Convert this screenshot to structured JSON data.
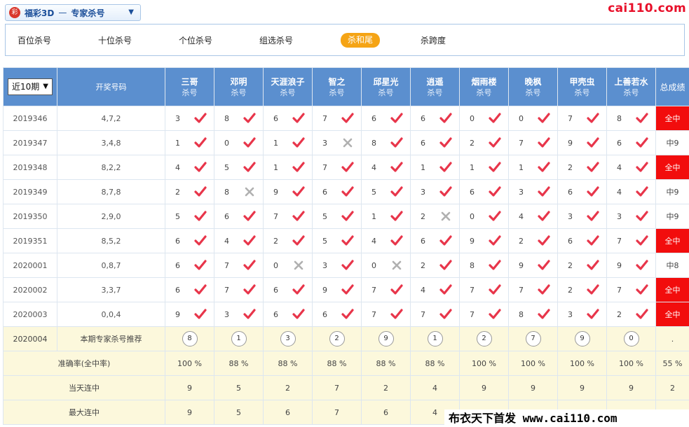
{
  "header": {
    "lottery": "福彩3D",
    "separator": "—",
    "section": "专家杀号",
    "brand": "cai110.com"
  },
  "tabs": [
    "百位杀号",
    "十位杀号",
    "个位杀号",
    "组选杀号",
    "杀和尾",
    "杀跨度"
  ],
  "active_tab": "杀和尾",
  "table": {
    "period_select": "近10期",
    "draw_header": "开奖号码",
    "total_header": "总成绩",
    "sub_label": "杀号",
    "experts": [
      "三哥",
      "邓明",
      "天涯浪子",
      "智之",
      "邱星光",
      "逍遥",
      "烟雨楼",
      "晚枫",
      "甲壳虫",
      "上善若水"
    ],
    "rows": [
      {
        "issue": "2019346",
        "draw": "4,7,2",
        "picks": [
          "3",
          "8",
          "6",
          "7",
          "6",
          "6",
          "0",
          "0",
          "7",
          "8"
        ],
        "hits": [
          true,
          true,
          true,
          true,
          true,
          true,
          true,
          true,
          true,
          true
        ],
        "total": "全中"
      },
      {
        "issue": "2019347",
        "draw": "3,4,8",
        "picks": [
          "1",
          "0",
          "1",
          "3",
          "8",
          "6",
          "2",
          "7",
          "9",
          "6"
        ],
        "hits": [
          true,
          true,
          true,
          false,
          true,
          true,
          true,
          true,
          true,
          true
        ],
        "total": "中9"
      },
      {
        "issue": "2019348",
        "draw": "8,2,2",
        "picks": [
          "4",
          "5",
          "1",
          "7",
          "4",
          "1",
          "1",
          "1",
          "2",
          "4"
        ],
        "hits": [
          true,
          true,
          true,
          true,
          true,
          true,
          true,
          true,
          true,
          true
        ],
        "total": "全中"
      },
      {
        "issue": "2019349",
        "draw": "8,7,8",
        "picks": [
          "2",
          "8",
          "9",
          "6",
          "5",
          "3",
          "6",
          "3",
          "6",
          "4"
        ],
        "hits": [
          true,
          false,
          true,
          true,
          true,
          true,
          true,
          true,
          true,
          true
        ],
        "total": "中9"
      },
      {
        "issue": "2019350",
        "draw": "2,9,0",
        "picks": [
          "5",
          "6",
          "7",
          "5",
          "1",
          "2",
          "0",
          "4",
          "3",
          "3"
        ],
        "hits": [
          true,
          true,
          true,
          true,
          true,
          false,
          true,
          true,
          true,
          true
        ],
        "total": "中9"
      },
      {
        "issue": "2019351",
        "draw": "8,5,2",
        "picks": [
          "6",
          "4",
          "2",
          "5",
          "4",
          "6",
          "9",
          "2",
          "6",
          "7"
        ],
        "hits": [
          true,
          true,
          true,
          true,
          true,
          true,
          true,
          true,
          true,
          true
        ],
        "total": "全中"
      },
      {
        "issue": "2020001",
        "draw": "0,8,7",
        "picks": [
          "6",
          "7",
          "0",
          "3",
          "0",
          "2",
          "8",
          "9",
          "2",
          "9"
        ],
        "hits": [
          true,
          true,
          false,
          true,
          false,
          true,
          true,
          true,
          true,
          true
        ],
        "total": "中8"
      },
      {
        "issue": "2020002",
        "draw": "3,3,7",
        "picks": [
          "6",
          "7",
          "6",
          "9",
          "7",
          "4",
          "7",
          "7",
          "2",
          "7"
        ],
        "hits": [
          true,
          true,
          true,
          true,
          true,
          true,
          true,
          true,
          true,
          true
        ],
        "total": "全中"
      },
      {
        "issue": "2020003",
        "draw": "0,0,4",
        "picks": [
          "9",
          "3",
          "6",
          "6",
          "7",
          "7",
          "7",
          "8",
          "3",
          "2"
        ],
        "hits": [
          true,
          true,
          true,
          true,
          true,
          true,
          true,
          true,
          true,
          true
        ],
        "total": "全中"
      }
    ],
    "recommend": {
      "issue": "2020004",
      "label": "本期专家杀号推荐",
      "balls": [
        "8",
        "1",
        "3",
        "2",
        "9",
        "1",
        "2",
        "7",
        "9",
        "0"
      ],
      "total": "."
    },
    "accuracy": {
      "label": "准确率(全中率)",
      "values": [
        "100 %",
        "88 %",
        "88 %",
        "88 %",
        "88 %",
        "88 %",
        "100 %",
        "100 %",
        "100 %",
        "100 %"
      ],
      "total": "55 %"
    },
    "current_streak": {
      "label": "当天连中",
      "values": [
        "9",
        "5",
        "2",
        "7",
        "2",
        "4",
        "9",
        "9",
        "9",
        "9"
      ],
      "total": "2"
    },
    "max_streak": {
      "label": "最大连中",
      "values": [
        "9",
        "5",
        "6",
        "7",
        "6",
        "4",
        "",
        "",
        "",
        ""
      ],
      "total": ""
    }
  },
  "watermark": "布衣天下首发 www.cai110.com",
  "colors": {
    "header_blue": "#5b8fcf",
    "hit_red": "#e8354a",
    "miss_gray": "#b0b0b0",
    "full_hit_bg": "#f20d0d",
    "tab_active": "#f5a415",
    "summary_yellow": "#fcf8dc"
  }
}
